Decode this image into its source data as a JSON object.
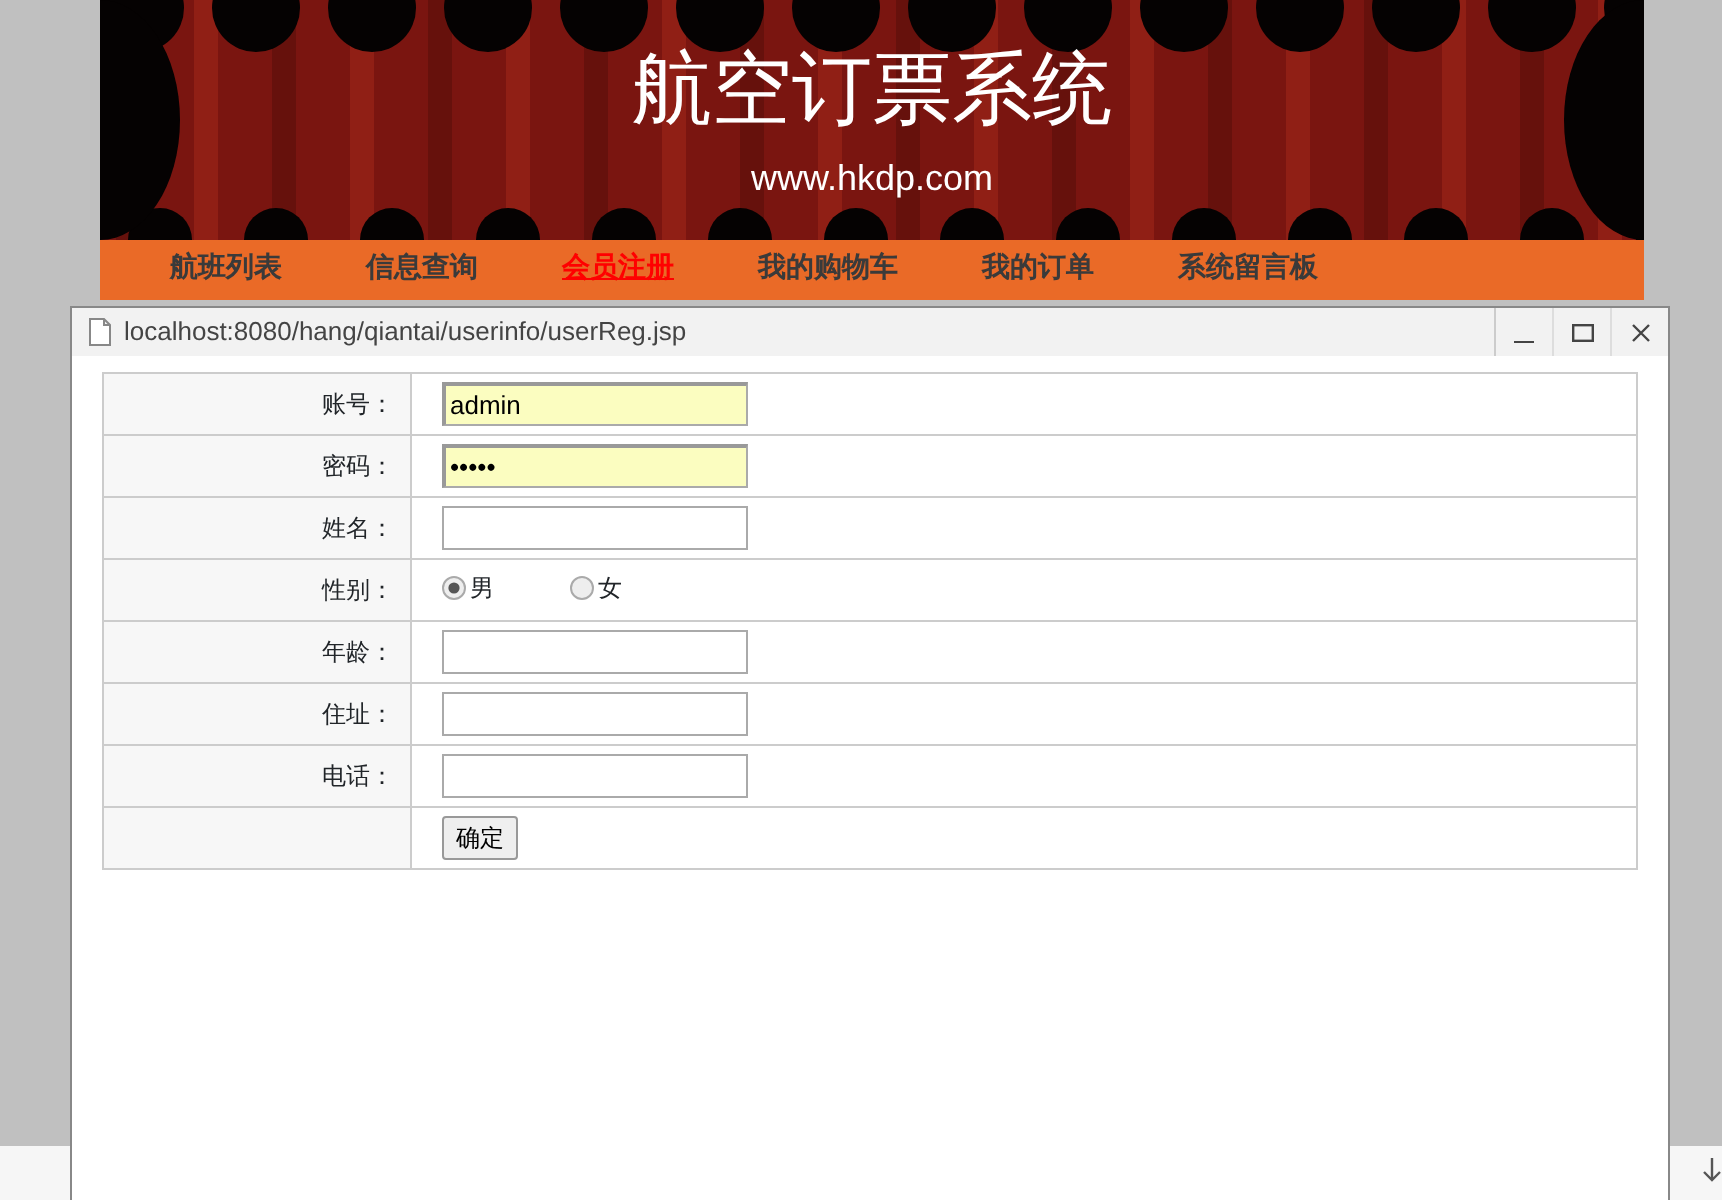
{
  "banner": {
    "title": "航空订票系统",
    "site": "www.hkdp.com"
  },
  "nav": [
    {
      "label": "航班列表",
      "selected": false
    },
    {
      "label": "信息查询",
      "selected": false
    },
    {
      "label": "会员注册",
      "selected": true
    },
    {
      "label": "我的购物车",
      "selected": false
    },
    {
      "label": "我的订单",
      "selected": false
    },
    {
      "label": "系统留言板",
      "selected": false
    }
  ],
  "popup": {
    "url": "localhost:8080/hang/qiantai/userinfo/userReg.jsp"
  },
  "form": [
    {
      "kind": "text",
      "label": "账号：",
      "value": "admin",
      "autofill": true
    },
    {
      "kind": "text",
      "label": "密码：",
      "value": "•••••",
      "autofill": true
    },
    {
      "kind": "text",
      "label": "姓名："
    },
    {
      "kind": "radio",
      "label": "性别：",
      "options": [
        {
          "label": "男",
          "selected": true
        },
        {
          "label": "女",
          "selected": false
        }
      ]
    },
    {
      "kind": "text",
      "label": "年龄："
    },
    {
      "kind": "text",
      "label": "住址："
    },
    {
      "kind": "text",
      "label": "电话："
    },
    {
      "kind": "button",
      "button": "确定"
    }
  ]
}
